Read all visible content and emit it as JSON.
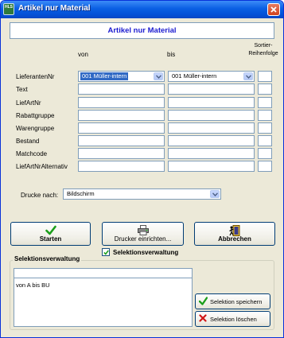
{
  "window": {
    "title": "Artikel nur Material",
    "app_icon_text": "HLS"
  },
  "header": {
    "title": "Artikel nur Material"
  },
  "columns": {
    "from": "von",
    "to": "bis",
    "sort": "Sortier-\nReihenfolge"
  },
  "rows": [
    {
      "label": "LieferantenNr",
      "from": "001 Müller-intern",
      "to": "001 Müller-intern"
    },
    {
      "label": "Text",
      "from": "",
      "to": ""
    },
    {
      "label": "LiefArtNr",
      "from": "",
      "to": ""
    },
    {
      "label": "Rabattgruppe",
      "from": "",
      "to": ""
    },
    {
      "label": "Warengruppe",
      "from": "",
      "to": ""
    },
    {
      "label": "Bestand",
      "from": "",
      "to": ""
    },
    {
      "label": "Matchcode",
      "from": "",
      "to": ""
    },
    {
      "label": "LiefArtNrAlternativ",
      "from": "",
      "to": ""
    }
  ],
  "print": {
    "label": "Drucke nach:",
    "value": "Bildschirm"
  },
  "buttons": {
    "start": "Starten",
    "printer_setup": "Drucker einrichten...",
    "cancel": "Abbrechen"
  },
  "selection": {
    "checkbox_label": "Selektionsverwaltung",
    "checked": true,
    "group_title": "Selektionsverwaltung",
    "name_value": "",
    "list": [
      "von A bis BU"
    ],
    "save_label": "Selektion speichern",
    "delete_label": "Selektion löschen"
  },
  "colors": {
    "title_bar": "#0a5fe3",
    "header_text": "#1c1cd0",
    "selection": "#316ac5",
    "accent_green": "#1a9e1a",
    "accent_red": "#d01818"
  }
}
